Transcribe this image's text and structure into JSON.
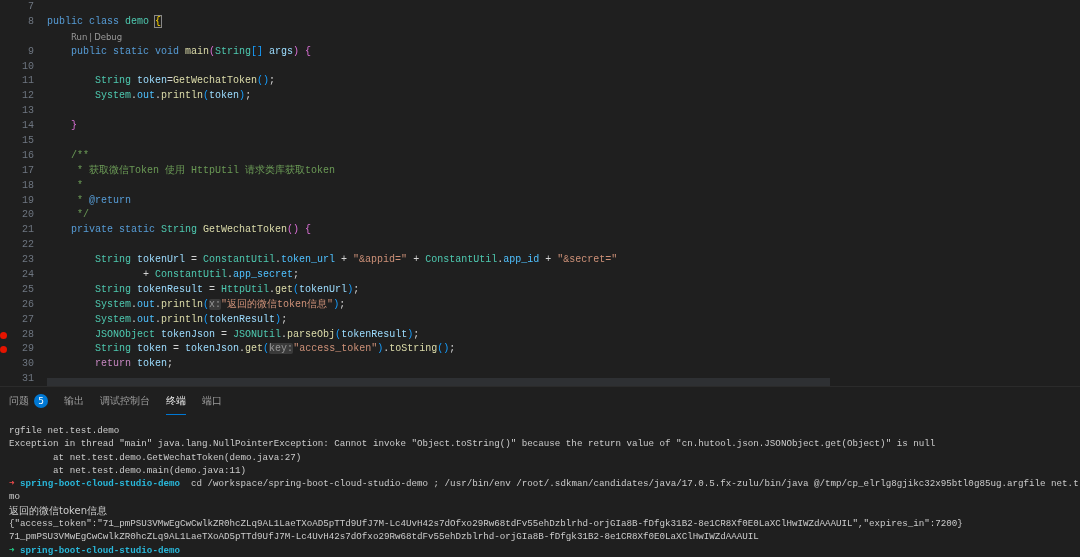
{
  "editor": {
    "lines": [
      {
        "kind": "code",
        "number": "7",
        "breakpoint": false
      },
      {
        "kind": "code",
        "number": "8",
        "breakpoint": false,
        "segs": [
          {
            "kind": "kw",
            "text": "public class "
          },
          {
            "kind": "type",
            "text": "demo "
          },
          {
            "kind": "match",
            "text": "{"
          }
        ]
      },
      {
        "kind": "codelens",
        "items": [
          "Run",
          "Debug"
        ],
        "separator": "|"
      },
      {
        "kind": "code",
        "number": "9",
        "breakpoint": false,
        "segs": [
          {
            "kind": "kw",
            "text": "    public static void "
          },
          {
            "kind": "fn",
            "text": "main"
          },
          {
            "kind": "b2",
            "text": "("
          },
          {
            "kind": "type",
            "text": "String"
          },
          {
            "kind": "b3",
            "text": "[] "
          },
          {
            "kind": "var",
            "text": "args"
          },
          {
            "kind": "b2",
            "text": ") {"
          }
        ]
      },
      {
        "kind": "code",
        "number": "10",
        "breakpoint": false
      },
      {
        "kind": "code",
        "number": "11",
        "breakpoint": false,
        "segs": [
          {
            "kind": "type",
            "text": "        String "
          },
          {
            "kind": "var",
            "text": "token"
          },
          {
            "kind": "p",
            "text": "="
          },
          {
            "kind": "fn",
            "text": "GetWechatToken"
          },
          {
            "kind": "b3",
            "text": "()"
          },
          {
            "kind": "p",
            "text": ";"
          }
        ]
      },
      {
        "kind": "code",
        "number": "12",
        "breakpoint": false,
        "segs": [
          {
            "kind": "type",
            "text": "        System"
          },
          {
            "kind": "p",
            "text": "."
          },
          {
            "kind": "var2",
            "text": "out"
          },
          {
            "kind": "p",
            "text": "."
          },
          {
            "kind": "fn",
            "text": "println"
          },
          {
            "kind": "b3",
            "text": "("
          },
          {
            "kind": "var",
            "text": "token"
          },
          {
            "kind": "b3",
            "text": ")"
          },
          {
            "kind": "p",
            "text": ";"
          }
        ]
      },
      {
        "kind": "code",
        "number": "13",
        "breakpoint": false
      },
      {
        "kind": "code",
        "number": "14",
        "breakpoint": false,
        "segs": [
          {
            "kind": "b2",
            "text": "    }"
          }
        ]
      },
      {
        "kind": "code",
        "number": "15",
        "breakpoint": false
      },
      {
        "kind": "code",
        "number": "16",
        "breakpoint": false,
        "segs": [
          {
            "kind": "cmt",
            "text": "    /**"
          }
        ]
      },
      {
        "kind": "code",
        "number": "17",
        "breakpoint": false,
        "segs": [
          {
            "kind": "cmt",
            "text": "     * 获取微信Token 使用 HttpUtil 请求类库获取token"
          }
        ]
      },
      {
        "kind": "code",
        "number": "18",
        "breakpoint": false,
        "segs": [
          {
            "kind": "cmt",
            "text": "     *"
          }
        ]
      },
      {
        "kind": "code",
        "number": "19",
        "breakpoint": false,
        "segs": [
          {
            "kind": "cmt",
            "text": "     * "
          },
          {
            "kind": "tag",
            "text": "@return"
          }
        ]
      },
      {
        "kind": "code",
        "number": "20",
        "breakpoint": false,
        "segs": [
          {
            "kind": "cmt",
            "text": "     */"
          }
        ]
      },
      {
        "kind": "code",
        "number": "21",
        "breakpoint": false,
        "segs": [
          {
            "kind": "kw",
            "text": "    private static "
          },
          {
            "kind": "type",
            "text": "String "
          },
          {
            "kind": "fn",
            "text": "GetWechatToken"
          },
          {
            "kind": "b2",
            "text": "() {"
          }
        ]
      },
      {
        "kind": "code",
        "number": "22",
        "breakpoint": false
      },
      {
        "kind": "code",
        "number": "23",
        "breakpoint": false,
        "segs": [
          {
            "kind": "type",
            "text": "        String "
          },
          {
            "kind": "var",
            "text": "tokenUrl"
          },
          {
            "kind": "p",
            "text": " = "
          },
          {
            "kind": "type",
            "text": "ConstantUtil"
          },
          {
            "kind": "p",
            "text": "."
          },
          {
            "kind": "var2",
            "text": "token_url"
          },
          {
            "kind": "p",
            "text": " + "
          },
          {
            "kind": "str",
            "text": "\"&appid=\""
          },
          {
            "kind": "p",
            "text": " + "
          },
          {
            "kind": "type",
            "text": "ConstantUtil"
          },
          {
            "kind": "p",
            "text": "."
          },
          {
            "kind": "var2",
            "text": "app_id"
          },
          {
            "kind": "p",
            "text": " + "
          },
          {
            "kind": "str",
            "text": "\"&secret=\""
          }
        ]
      },
      {
        "kind": "code",
        "number": "24",
        "breakpoint": false,
        "segs": [
          {
            "kind": "p",
            "text": "                + "
          },
          {
            "kind": "type",
            "text": "ConstantUtil"
          },
          {
            "kind": "p",
            "text": "."
          },
          {
            "kind": "var2",
            "text": "app_secret"
          },
          {
            "kind": "p",
            "text": ";"
          }
        ]
      },
      {
        "kind": "code",
        "number": "25",
        "breakpoint": false,
        "segs": [
          {
            "kind": "type",
            "text": "        String "
          },
          {
            "kind": "var",
            "text": "tokenResult"
          },
          {
            "kind": "p",
            "text": " = "
          },
          {
            "kind": "type",
            "text": "HttpUtil"
          },
          {
            "kind": "p",
            "text": "."
          },
          {
            "kind": "fn",
            "text": "get"
          },
          {
            "kind": "b3",
            "text": "("
          },
          {
            "kind": "var",
            "text": "tokenUrl"
          },
          {
            "kind": "b3",
            "text": ")"
          },
          {
            "kind": "p",
            "text": ";"
          }
        ]
      },
      {
        "kind": "code",
        "number": "26",
        "breakpoint": false,
        "segs": [
          {
            "kind": "type",
            "text": "        System"
          },
          {
            "kind": "p",
            "text": "."
          },
          {
            "kind": "var2",
            "text": "out"
          },
          {
            "kind": "p",
            "text": "."
          },
          {
            "kind": "fn",
            "text": "println"
          },
          {
            "kind": "b3",
            "text": "("
          },
          {
            "kind": "hint",
            "text": "x:"
          },
          {
            "kind": "str",
            "text": "\"返回的微信token信息\""
          },
          {
            "kind": "b3",
            "text": ")"
          },
          {
            "kind": "p",
            "text": ";"
          }
        ]
      },
      {
        "kind": "code",
        "number": "27",
        "breakpoint": false,
        "segs": [
          {
            "kind": "type",
            "text": "        System"
          },
          {
            "kind": "p",
            "text": "."
          },
          {
            "kind": "var2",
            "text": "out"
          },
          {
            "kind": "p",
            "text": "."
          },
          {
            "kind": "fn",
            "text": "println"
          },
          {
            "kind": "b3",
            "text": "("
          },
          {
            "kind": "var",
            "text": "tokenResult"
          },
          {
            "kind": "b3",
            "text": ")"
          },
          {
            "kind": "p",
            "text": ";"
          }
        ]
      },
      {
        "kind": "code",
        "number": "28",
        "breakpoint": true,
        "segs": [
          {
            "kind": "type",
            "text": "        JSONObject "
          },
          {
            "kind": "var",
            "text": "tokenJson"
          },
          {
            "kind": "p",
            "text": " = "
          },
          {
            "kind": "type",
            "text": "JSONUtil"
          },
          {
            "kind": "p",
            "text": "."
          },
          {
            "kind": "fn",
            "text": "parseObj"
          },
          {
            "kind": "b3",
            "text": "("
          },
          {
            "kind": "var",
            "text": "tokenResult"
          },
          {
            "kind": "b3",
            "text": ")"
          },
          {
            "kind": "p",
            "text": ";"
          }
        ]
      },
      {
        "kind": "code",
        "number": "29",
        "breakpoint": true,
        "segs": [
          {
            "kind": "type",
            "text": "        String "
          },
          {
            "kind": "var",
            "text": "token"
          },
          {
            "kind": "p",
            "text": " = "
          },
          {
            "kind": "var",
            "text": "tokenJson"
          },
          {
            "kind": "p",
            "text": "."
          },
          {
            "kind": "fn",
            "text": "get"
          },
          {
            "kind": "b3",
            "text": "("
          },
          {
            "kind": "hint",
            "text": "key:"
          },
          {
            "kind": "str",
            "text": "\"access_token\""
          },
          {
            "kind": "b3",
            "text": ")"
          },
          {
            "kind": "p",
            "text": "."
          },
          {
            "kind": "fn",
            "text": "toString"
          },
          {
            "kind": "b3",
            "text": "()"
          },
          {
            "kind": "p",
            "text": ";"
          }
        ]
      },
      {
        "kind": "code",
        "number": "30",
        "breakpoint": false,
        "segs": [
          {
            "kind": "ctl",
            "text": "        return "
          },
          {
            "kind": "var",
            "text": "token"
          },
          {
            "kind": "p",
            "text": ";"
          }
        ]
      },
      {
        "kind": "code",
        "number": "31",
        "breakpoint": false
      }
    ]
  },
  "panel": {
    "tabs": [
      {
        "label": "问题",
        "badge": "5",
        "selected": false
      },
      {
        "label": "输出",
        "selected": false
      },
      {
        "label": "调试控制台",
        "selected": false
      },
      {
        "label": "终端",
        "selected": true
      },
      {
        "label": "端口",
        "selected": false
      }
    ],
    "terminal": [
      {
        "kind": "text",
        "text": "rgfile net.test.demo"
      },
      {
        "kind": "text",
        "text": "Exception in thread \"main\" java.lang.NullPointerException: Cannot invoke \"Object.toString()\" because the return value of \"cn.hutool.json.JSONObject.get(Object)\" is null"
      },
      {
        "kind": "text",
        "text": "        at net.test.demo.GetWechatToken(demo.java:27)"
      },
      {
        "kind": "text",
        "text": "        at net.test.demo.main(demo.java:11)"
      },
      {
        "kind": "prompt",
        "failed": true,
        "arrow": "➜",
        "dir": "spring-boot-cloud-studio-demo",
        "command": "cd /workspace/spring-boot-cloud-studio-demo ; /usr/bin/env /root/.sdkman/candidates/java/17.0.5.fx-zulu/bin/java @/tmp/cp_elrlg8gjikc32x95btl0g85ug.argfile net.t"
      },
      {
        "kind": "text",
        "text": "mo"
      },
      {
        "kind": "text",
        "text": "返回的微信token信息"
      },
      {
        "kind": "text",
        "text": "{\"access_token\":\"71_pmPSU3VMwEgCwCwlkZR0hcZLq9AL1LaeTXoAD5pTTd9UfJ7M-Lc4UvH42s7dOfxo29Rw68tdFv55ehDzblrhd-orjGIa8B-fDfgk31B2-8e1CR8Xf0E0LaXClHwIWZdAAAUIL\",\"expires_in\":7200}"
      },
      {
        "kind": "text",
        "text": "71_pmPSU3VMwEgCwCwlkZR0hcZLq9AL1LaeTXoAD5pTTd9UfJ7M-Lc4UvH42s7dOfxo29Rw68tdFv55ehDzblrhd-orjGIa8B-fDfgk31B2-8e1CR8Xf0E0LaXClHwIWZdAAAUIL"
      },
      {
        "kind": "prompt",
        "failed": false,
        "arrow": "➜",
        "dir": "spring-boot-cloud-studio-demo"
      }
    ]
  }
}
